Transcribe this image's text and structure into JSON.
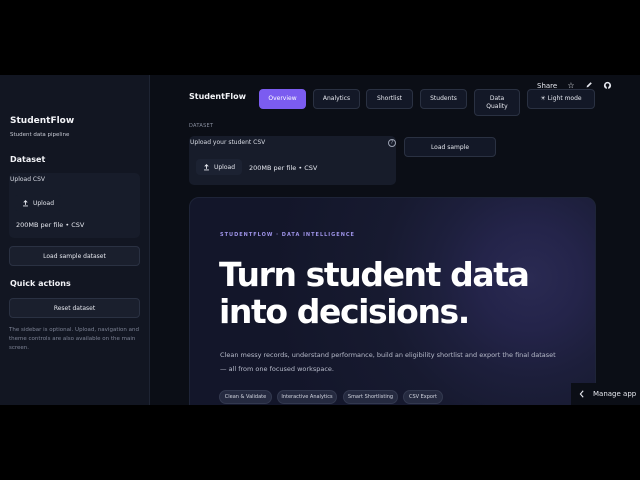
{
  "sidebar": {
    "app_title": "StudentFlow",
    "app_subtitle": "Student data pipeline",
    "dataset_heading": "Dataset",
    "upload_label": "Upload CSV",
    "upload_button": "Upload",
    "upload_limit": "200MB per file • CSV",
    "load_sample_button": "Load sample dataset",
    "quick_actions_heading": "Quick actions",
    "reset_button": "Reset dataset",
    "note": "The sidebar is optional. Upload, navigation and theme controls are also available on the main screen."
  },
  "header": {
    "brand": "StudentFlow",
    "tabs": [
      {
        "label": "Overview",
        "active": true
      },
      {
        "label": "Analytics",
        "active": false
      },
      {
        "label": "Shortlist",
        "active": false
      },
      {
        "label": "Students",
        "active": false
      },
      {
        "label": "Data Quality",
        "active": false
      }
    ],
    "theme_button": "☀ Light mode",
    "share": "Share"
  },
  "main": {
    "dataset_label": "DATASET",
    "upload_label": "Upload your student CSV",
    "upload_button": "Upload",
    "upload_limit": "200MB per file • CSV",
    "load_sample_button": "Load sample"
  },
  "hero": {
    "eyebrow": "STUDENTFLOW · DATA INTELLIGENCE",
    "title_line1": "Turn student data",
    "title_line2": "into decisions.",
    "description": "Clean messy records, understand performance, build an eligibility shortlist and export the final dataset — all from one focused workspace.",
    "chips": [
      "Clean & Validate",
      "Interactive Analytics",
      "Smart Shortlisting",
      "CSV Export"
    ]
  },
  "footer": {
    "manage_app": "Manage app"
  },
  "colors": {
    "accent": "#7b5cf0",
    "background": "#0b0e16",
    "sidebar": "#121622"
  }
}
